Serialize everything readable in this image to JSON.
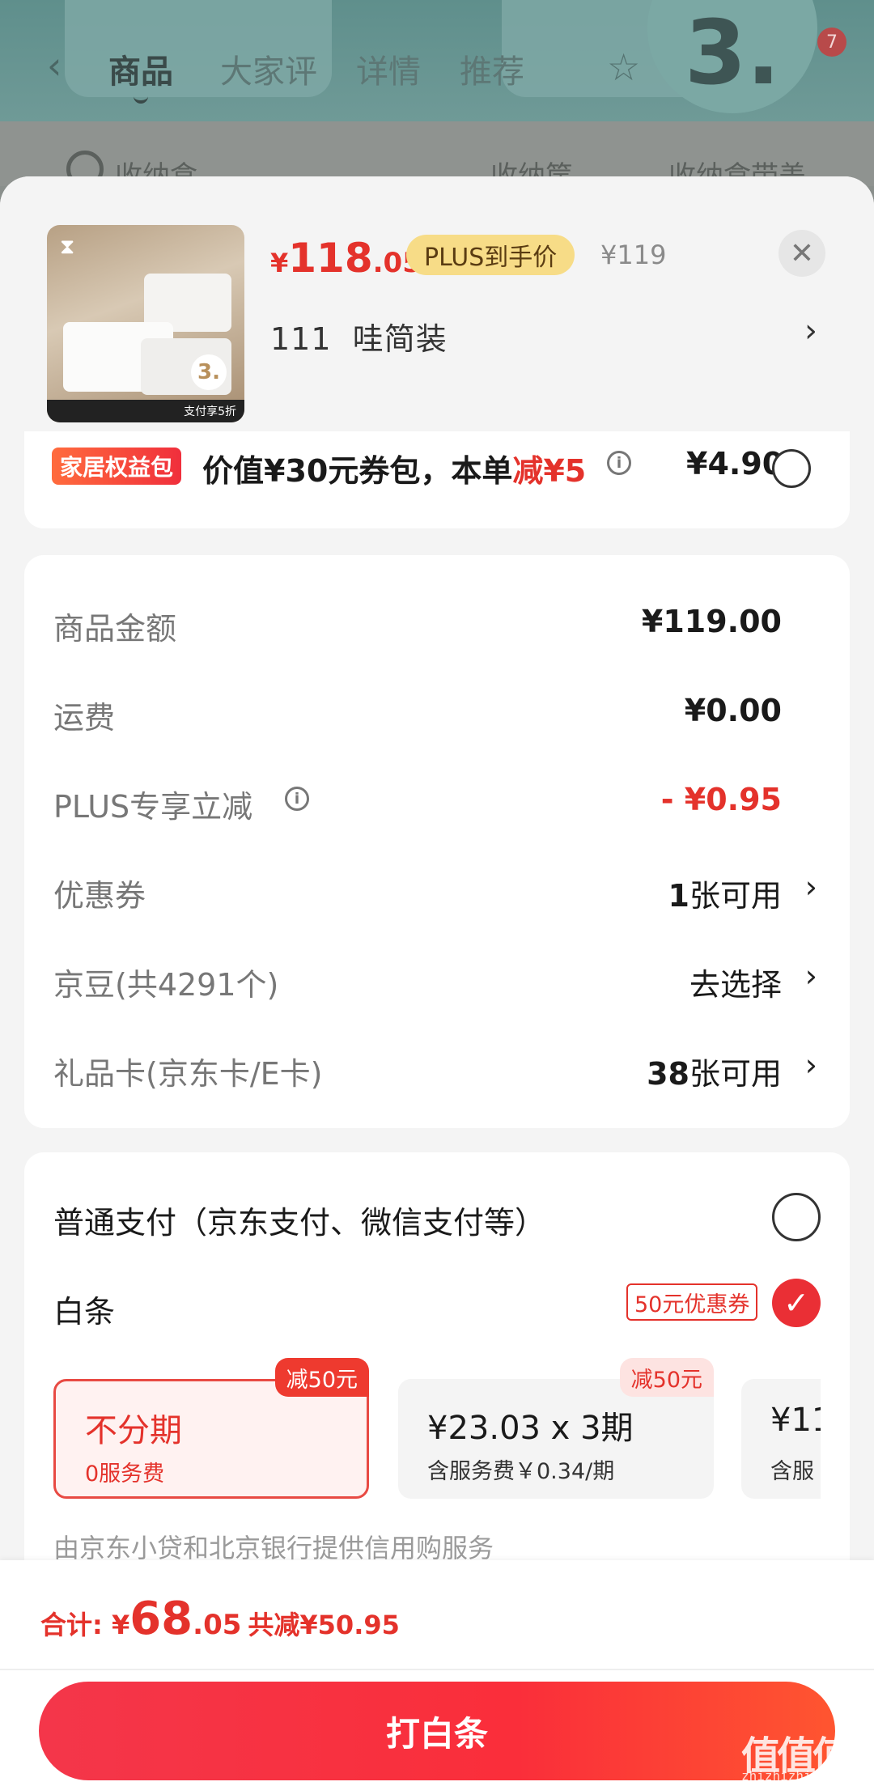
{
  "background": {
    "tabs": [
      "商品",
      "大家评",
      "详情",
      "推荐"
    ],
    "cart_count": "7",
    "badge_number": "3.",
    "search_terms": [
      "收纳盒",
      "收纳筐",
      "收纳盒带盖"
    ]
  },
  "product": {
    "price_yen": "¥",
    "price_int": "118",
    "price_dec": ".05",
    "plus_tag": "PLUS到手价",
    "original_price": "¥119",
    "spec": "111  哇简装",
    "thumb_badge": "3.",
    "thumb_strip": "支付享5折"
  },
  "benefit": {
    "tag": "家居权益包",
    "text_prefix": "价值¥30元券包，本单",
    "text_red": "减¥5",
    "price": "¥4.90"
  },
  "amounts": {
    "rows": [
      {
        "label": "商品金额",
        "value": "¥119.00"
      },
      {
        "label": "运费",
        "value": "¥0.00"
      },
      {
        "label": "PLUS专享立减",
        "value": "- ¥0.95"
      },
      {
        "label": "优惠券",
        "value_num": "1",
        "value_text": "张可用"
      },
      {
        "label": "京豆(共4291个)",
        "value_text": "去选择"
      },
      {
        "label": "礼品卡(京东卡/E卡)",
        "value_num": "38",
        "value_text": "张可用"
      }
    ]
  },
  "payment": {
    "normal_label": "普通支付（京东支付、微信支付等）",
    "baitiao_label": "白条",
    "coupon_tag": "50元优惠券",
    "plans": [
      {
        "title": "不分期",
        "sub": "0服务费",
        "corner": "减50元"
      },
      {
        "title": "¥23.03 x 3期",
        "sub": "含服务费￥0.34/期",
        "corner": "减50元"
      },
      {
        "title": "¥11",
        "sub": "含服"
      }
    ],
    "footnote": "由京东小贷和北京银行提供信用购服务"
  },
  "footer": {
    "total_label": "合计: ",
    "total_yen": "¥",
    "total_int": "68",
    "total_dec": ".05",
    "saved": "共减¥50.95",
    "button_label": "打白条"
  },
  "watermark": {
    "text": "值值值",
    "sub": "zhizhizhi.com"
  },
  "colors": {
    "accent": "#e4322b",
    "plus_gold": "#f7dc87",
    "sheet_bg": "#f4f4f4"
  }
}
